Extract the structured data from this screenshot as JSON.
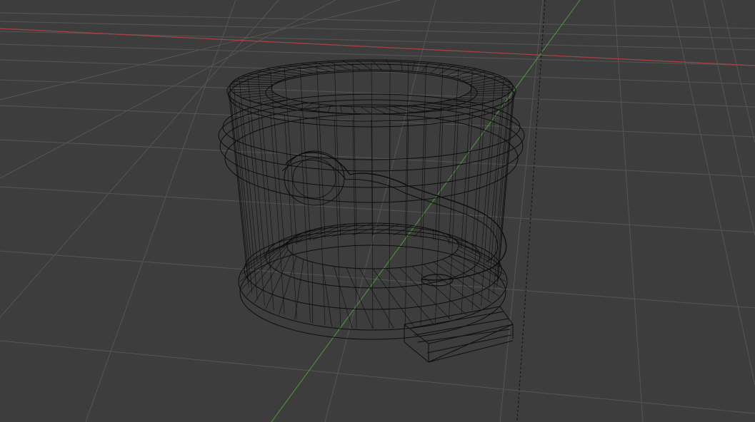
{
  "viewport": {
    "view_mode": "wireframe",
    "background_color": "#3d3d3d",
    "grid_color": "#555555",
    "x_axis_color": "#a54444",
    "y_axis_color": "#4c9b3a",
    "wire_color": "#0d0d0d"
  },
  "model": {
    "object": "hollow-cylinder-mesh",
    "display": "wireframe"
  }
}
